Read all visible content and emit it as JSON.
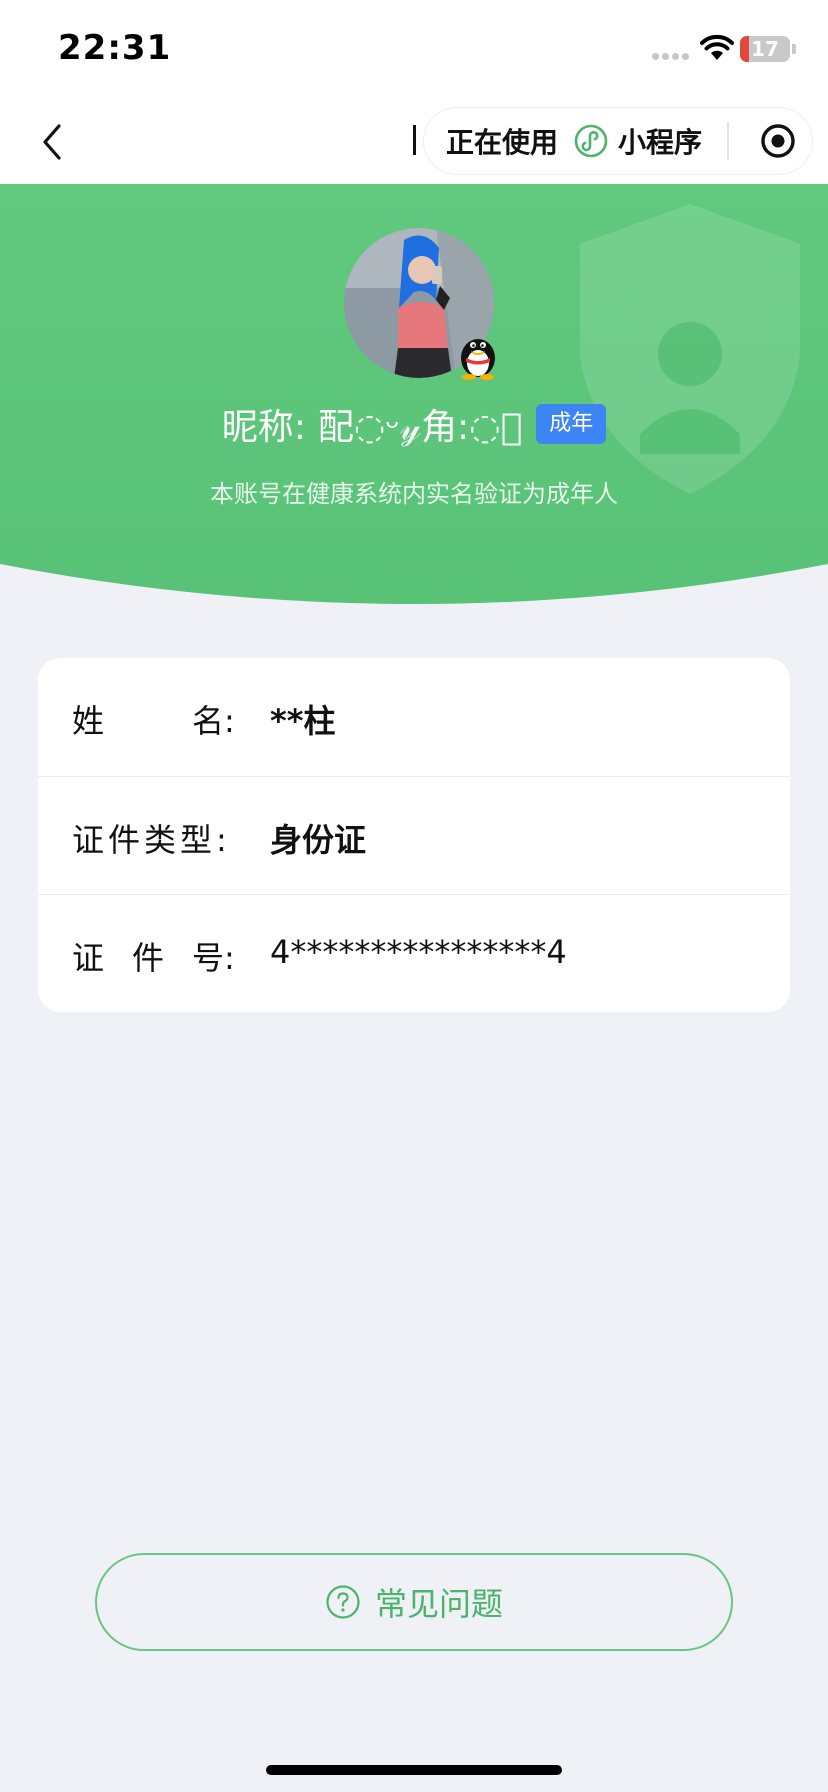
{
  "status_bar": {
    "time": "22:31",
    "battery_level": "17",
    "battery_fraction": 0.17,
    "icons": [
      "signal-dots-icon",
      "wifi-icon",
      "battery-icon"
    ]
  },
  "nav": {
    "back_icon": "chevron-left-icon",
    "capsule": {
      "using_label": "正在使用",
      "mini_program_label": "小程序",
      "mini_program_icon": "mini-program-icon",
      "target_icon": "target-icon"
    }
  },
  "profile": {
    "avatar_icon": "user-avatar",
    "platform_badge_icon": "qq-penguin-icon",
    "nickname_label": "昵称:",
    "nickname_value": "配◌ᵕ𝓎角:◌᪼",
    "age_badge": "成年",
    "verification_text": "本账号在健康系统内实名验证为成年人"
  },
  "identity": {
    "name_label_chars": [
      "姓",
      "名:"
    ],
    "name_value": "**柱",
    "id_type_label": "证件类型:",
    "id_type_value": "身份证",
    "id_number_label_chars": [
      "证",
      "件",
      "号:"
    ],
    "id_number_value": "4****************4"
  },
  "faq_button": {
    "icon": "question-circle-icon",
    "label": "常见问题"
  },
  "colors": {
    "brand_green": "#5cc57b",
    "badge_blue": "#3d84f4",
    "page_background": "#eff1f6",
    "battery_low": "#e2473e"
  }
}
